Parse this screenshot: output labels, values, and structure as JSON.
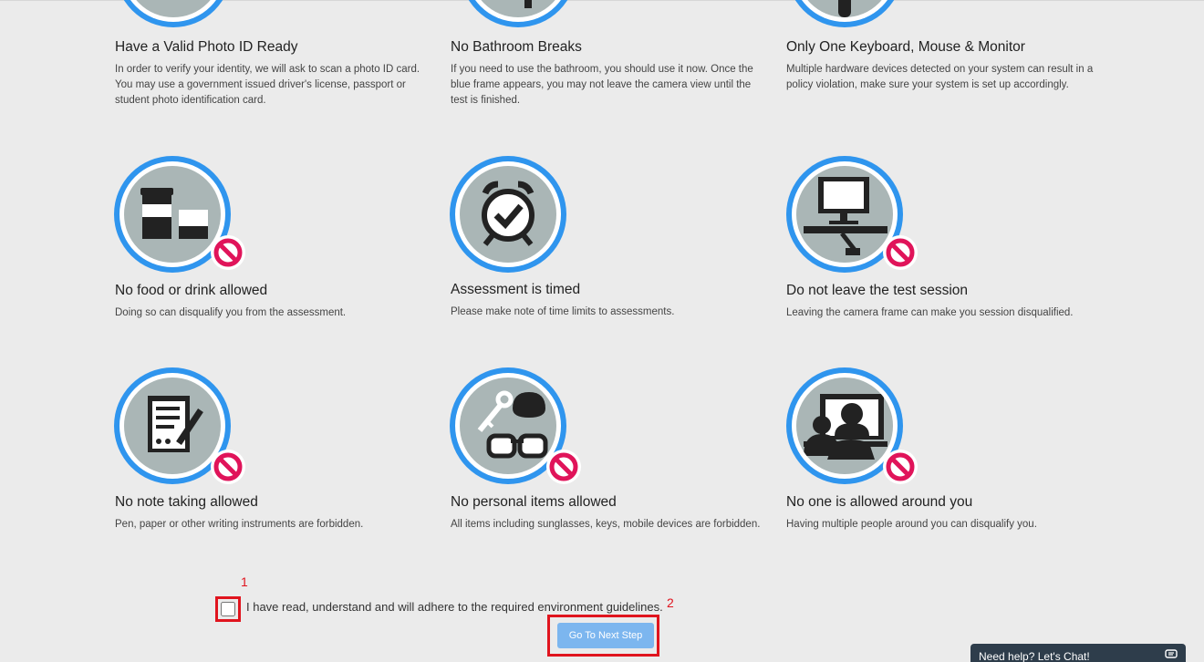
{
  "rules": [
    {
      "id": "photo-id",
      "title": "Have a Valid Photo ID Ready",
      "desc": "In order to verify your identity, we will ask to scan a photo ID card. You may use a government issued driver's license, passport or student photo identification card.",
      "icon": "id-card-icon",
      "forbidden": false
    },
    {
      "id": "bathroom",
      "title": "No Bathroom Breaks",
      "desc": "If you need to use the bathroom, you should use it now. Once the blue frame appears, you may not leave the camera view until the test is finished.",
      "icon": "bathroom-icon",
      "forbidden": false
    },
    {
      "id": "hardware",
      "title": "Only One Keyboard, Mouse & Monitor",
      "desc": "Multiple hardware devices detected on your system can result in a policy violation, make sure your system is set up accordingly.",
      "icon": "mouse-icon",
      "forbidden": false
    },
    {
      "id": "food",
      "title": "No food or drink allowed",
      "desc": "Doing so can disqualify you from the assessment.",
      "icon": "drink-cups-icon",
      "forbidden": true
    },
    {
      "id": "timed",
      "title": "Assessment is timed",
      "desc": "Please make note of time limits to assessments.",
      "icon": "alarm-clock-icon",
      "forbidden": false
    },
    {
      "id": "leave",
      "title": "Do not leave the test session",
      "desc": "Leaving the camera frame can make you session disqualified.",
      "icon": "desk-monitor-icon",
      "forbidden": true
    },
    {
      "id": "notes",
      "title": "No note taking allowed",
      "desc": "Pen, paper or other writing instruments are forbidden.",
      "icon": "notepad-pen-icon",
      "forbidden": true
    },
    {
      "id": "personal",
      "title": "No personal items allowed",
      "desc": "All items including sunglasses, keys, mobile devices are forbidden.",
      "icon": "personal-items-icon",
      "forbidden": true
    },
    {
      "id": "people",
      "title": "No one is allowed around you",
      "desc": "Having multiple people around you can disqualify you.",
      "icon": "people-headset-icon",
      "forbidden": true
    }
  ],
  "agreement": {
    "label": "I have read, understand and will adhere to the required environment guidelines.",
    "checked": false
  },
  "annotations": {
    "checkbox_mark": "1",
    "button_mark": "2"
  },
  "next_button": {
    "label": "Go To Next Step"
  },
  "chat": {
    "label": "Need help? Let's Chat!"
  },
  "colors": {
    "ring": "#2f95ee",
    "disc": "#aab6b6",
    "forbidden": "#e0145a",
    "highlight": "#e0141e",
    "button": "#7cb6ef",
    "chat_bg": "#2e3d4b"
  }
}
